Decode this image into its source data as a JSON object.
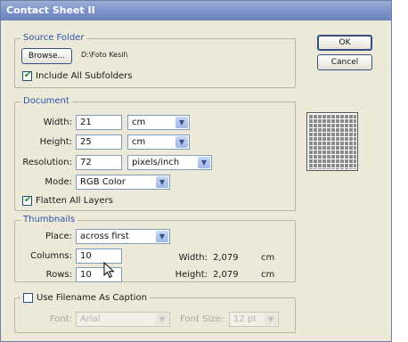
{
  "window": {
    "title": "Contact Sheet II"
  },
  "buttons": {
    "ok": "OK",
    "cancel": "Cancel"
  },
  "source_folder": {
    "legend": "Source Folder",
    "browse_label": "Browse...",
    "path": "D:\\Foto Kesil\\",
    "include_subfolders_label": "Include All Subfolders",
    "include_subfolders_checked": true
  },
  "document": {
    "legend": "Document",
    "width_label": "Width:",
    "width_value": "21",
    "width_unit": "cm",
    "height_label": "Height:",
    "height_value": "25",
    "height_unit": "cm",
    "resolution_label": "Resolution:",
    "resolution_value": "72",
    "resolution_unit": "pixels/inch",
    "mode_label": "Mode:",
    "mode_value": "RGB Color",
    "flatten_label": "Flatten All Layers",
    "flatten_checked": true
  },
  "thumbnails": {
    "legend": "Thumbnails",
    "place_label": "Place:",
    "place_value": "across first",
    "columns_label": "Columns:",
    "columns_value": "10",
    "rows_label": "Rows:",
    "rows_value": "10",
    "width_label": "Width:",
    "width_value": "2,079",
    "width_unit": "cm",
    "height_label": "Height:",
    "height_value": "2,079",
    "height_unit": "cm"
  },
  "caption": {
    "use_filename_label": "Use Filename As Caption",
    "use_filename_checked": false,
    "font_label": "Font:",
    "font_value": "Arial",
    "font_size_label": "Font Size:",
    "font_size_value": "12 pt"
  },
  "colors": {
    "title_bar": "#7f97cc",
    "group_legend": "#2a52a8",
    "dialog_bg": "#ece9d8"
  }
}
